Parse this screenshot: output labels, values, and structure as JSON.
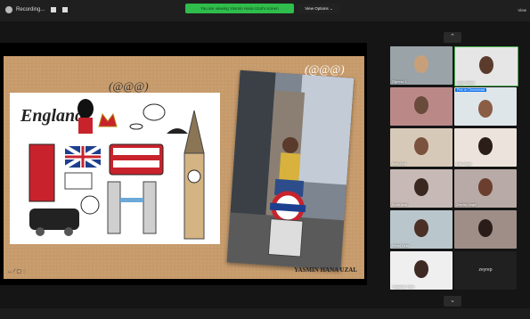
{
  "topbar": {
    "recording_label": "Recording...",
    "share_banner": "You are viewing Yasmin Hana Uzal's screen",
    "view_options": "View Options ⌄",
    "view_menu": "View"
  },
  "slide": {
    "england_title": "England",
    "glasses_text_1": "(@@@)",
    "glasses_text_2": "(@@@)",
    "author_name": "YASMIN HANA UZAL",
    "tools": "↔ ⁄ ▢ ◌"
  },
  "gallery": {
    "up_arrow": "⌃",
    "down_arrow": "⌄",
    "tiles": [
      {
        "name": "Öğrenci 1",
        "kind": "video"
      },
      {
        "name": "Ayla Yılmaz",
        "kind": "video"
      },
      {
        "name": "",
        "kind": "video"
      },
      {
        "name": "Pick on Chromecast",
        "kind": "video"
      },
      {
        "name": "Asel Akın",
        "kind": "video"
      },
      {
        "name": "Ekin Kaya",
        "kind": "video"
      },
      {
        "name": "Sude Akar",
        "kind": "video"
      },
      {
        "name": "Zeynep Akgül",
        "kind": "video"
      },
      {
        "name": "Sedef Özer",
        "kind": "video"
      },
      {
        "name": "",
        "kind": "video"
      },
      {
        "name": "Tolgahan Tekin",
        "kind": "video"
      },
      {
        "name": "zeyrep",
        "kind": "blank"
      }
    ]
  }
}
